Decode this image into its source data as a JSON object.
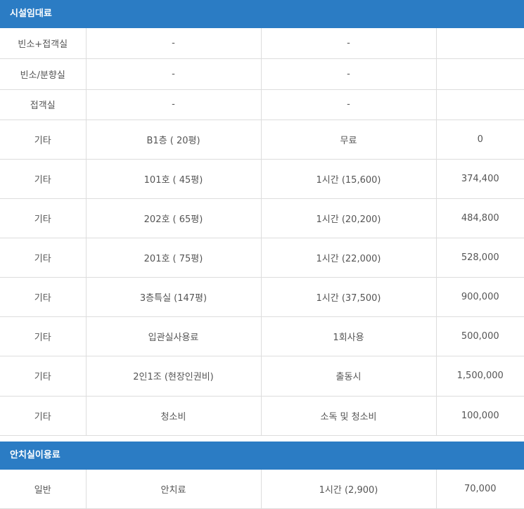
{
  "sections": [
    {
      "title": "시설임대료",
      "rows": [
        {
          "category": "빈소+접객실",
          "item": "-",
          "unit": "-",
          "price": ""
        },
        {
          "category": "빈소/분향실",
          "item": "-",
          "unit": "-",
          "price": ""
        },
        {
          "category": "접객실",
          "item": "-",
          "unit": "-",
          "price": ""
        },
        {
          "category": "기타",
          "item": "B1층 ( 20평)",
          "unit": "무료",
          "price": "0"
        },
        {
          "category": "기타",
          "item": "101호 ( 45평)",
          "unit": "1시간 (15,600)",
          "price": "374,400"
        },
        {
          "category": "기타",
          "item": "202호 ( 65평)",
          "unit": "1시간 (20,200)",
          "price": "484,800"
        },
        {
          "category": "기타",
          "item": "201호 ( 75평)",
          "unit": "1시간 (22,000)",
          "price": "528,000"
        },
        {
          "category": "기타",
          "item": "3층특실 (147평)",
          "unit": "1시간 (37,500)",
          "price": "900,000"
        },
        {
          "category": "기타",
          "item": "입관실사용료",
          "unit": "1회사용",
          "price": "500,000"
        },
        {
          "category": "기타",
          "item": "2인1조 (현장인권비)",
          "unit": "출동시",
          "price": "1,500,000"
        },
        {
          "category": "기타",
          "item": "청소비",
          "unit": "소독 및 청소비",
          "price": "100,000"
        }
      ]
    },
    {
      "title": "안치실이용료",
      "rows": [
        {
          "category": "일반",
          "item": "안치료",
          "unit": "1시간 (2,900)",
          "price": "70,000"
        }
      ]
    }
  ]
}
